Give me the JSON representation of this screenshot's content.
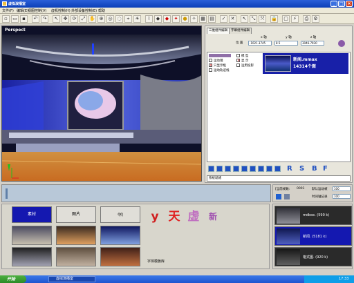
{
  "window": {
    "title": "虚拟演播室"
  },
  "menu": [
    {
      "label": "文件(F)"
    },
    {
      "label": "编辑(E)"
    },
    {
      "label": "视图控制(V)"
    },
    {
      "label": "虚机控制(H)"
    },
    {
      "label": "外部设备控制(E)"
    },
    {
      "label": "帮助"
    }
  ],
  "viewport": {
    "label": "Perspect"
  },
  "right_panel": {
    "tabs": [
      "三维组件编辑",
      "字幕组件编辑"
    ],
    "axis_labels": {
      "x": "x 轴",
      "y": "y 轴",
      "z": "z 轴"
    },
    "position_label": "位 置",
    "position_values": {
      "x": "-1021.3745",
      "y": "8.5",
      "z": "3046.7930"
    },
    "checks": [
      {
        "label": "模 型",
        "checked": false
      },
      {
        "label": "显 示",
        "checked": true
      },
      {
        "label": "运用投影",
        "checked": false
      },
      {
        "label": "运动镜",
        "checked": false
      },
      {
        "label": "只显示框",
        "checked": true
      },
      {
        "label": "运动轨迹线",
        "checked": false
      }
    ],
    "selected_object": {
      "name": "新闻.mmax",
      "count": "14314个面"
    },
    "letters": [
      "R",
      "S",
      "B",
      "F"
    ],
    "status_text": "系统就绪"
  },
  "time_panel": {
    "label_current": "[当前帧数:",
    "current_value": "0001",
    "label_speed": "默认运动帧",
    "speed_value": "100",
    "label_record": "时间轴记录",
    "record_value": "100"
  },
  "library": {
    "tabs": [
      "素材",
      "图片",
      "qq"
    ],
    "font_tiles": [
      "y",
      "天",
      "虚",
      "新"
    ],
    "font_label": "字体模板库"
  },
  "templates": [
    {
      "name": "mdbox. (590 k)"
    },
    {
      "name": "新闻. (5181 k)"
    },
    {
      "name": "格式图. (920 k)"
    }
  ],
  "taskbar": {
    "start": "开始",
    "task": "虚拟演播室",
    "clock": "17:33"
  },
  "colors": {
    "selection": "#1418b0",
    "titlebar": "#0b3fb8"
  }
}
